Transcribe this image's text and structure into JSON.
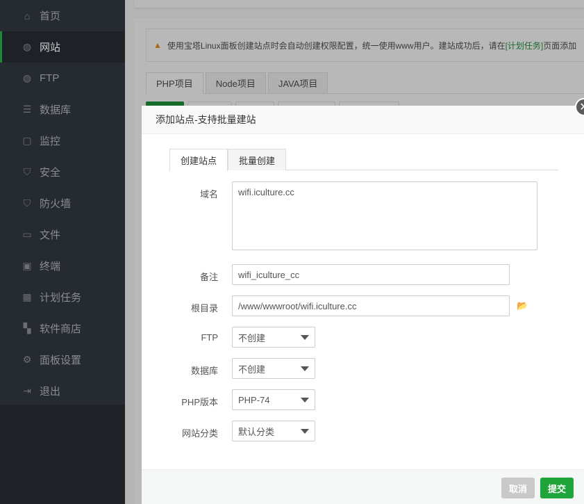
{
  "sidebar": {
    "items": [
      {
        "label": "首页",
        "icon": "home-icon",
        "glyph": "⌂"
      },
      {
        "label": "网站",
        "icon": "globe-icon",
        "glyph": "◍"
      },
      {
        "label": "FTP",
        "icon": "ftp-icon",
        "glyph": "◍"
      },
      {
        "label": "数据库",
        "icon": "database-icon",
        "glyph": "☰"
      },
      {
        "label": "监控",
        "icon": "monitor-icon",
        "glyph": "▢"
      },
      {
        "label": "安全",
        "icon": "shield-icon",
        "glyph": "⛉"
      },
      {
        "label": "防火墙",
        "icon": "firewall-icon",
        "glyph": "⛉"
      },
      {
        "label": "文件",
        "icon": "folder-icon",
        "glyph": "▭"
      },
      {
        "label": "终端",
        "icon": "terminal-icon",
        "glyph": "▣"
      },
      {
        "label": "计划任务",
        "icon": "calendar-icon",
        "glyph": "▦"
      },
      {
        "label": "软件商店",
        "icon": "apps-icon",
        "glyph": "▚"
      },
      {
        "label": "面板设置",
        "icon": "gear-icon",
        "glyph": "⚙"
      },
      {
        "label": "退出",
        "icon": "logout-icon",
        "glyph": "⇥"
      }
    ],
    "active": "网站"
  },
  "notice": {
    "text": "使用宝塔Linux面板创建站点时会自动创建权限配置，统一使用www用户。建站成功后，请在",
    "link": "[计划任务]",
    "after": "页面添加"
  },
  "project_tabs": [
    "PHP项目",
    "Node项目",
    "JAVA项目"
  ],
  "modal": {
    "title": "添加站点-支持批量建站",
    "tabs": [
      "创建站点",
      "批量创建"
    ],
    "fields": {
      "domain": {
        "label": "域名",
        "value": "wifi.iculture.cc"
      },
      "remark": {
        "label": "备注",
        "value": "wifi_iculture_cc"
      },
      "root": {
        "label": "根目录",
        "value": "/www/wwwroot/wifi.iculture.cc"
      },
      "ftp": {
        "label": "FTP",
        "value": "不创建"
      },
      "database": {
        "label": "数据库",
        "value": "不创建"
      },
      "php": {
        "label": "PHP版本",
        "value": "PHP-74"
      },
      "category": {
        "label": "网站分类",
        "value": "默认分类"
      }
    },
    "cancel": "取消",
    "submit": "提交",
    "close": "✕"
  },
  "colors": {
    "accent": "#20a53a",
    "sidebar": "#262a31"
  }
}
